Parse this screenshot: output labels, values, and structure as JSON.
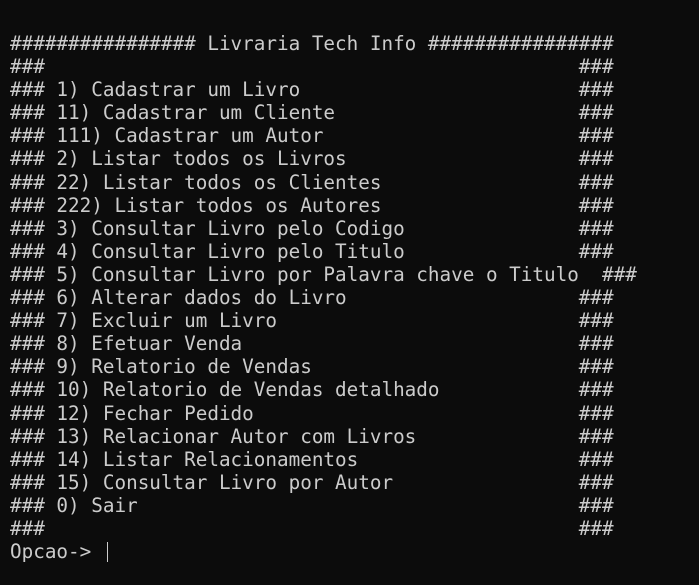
{
  "terminal": {
    "lines": [
      "################ Livraria Tech Info ################",
      "###                                              ###",
      "### 1) Cadastrar um Livro                        ###",
      "### 11) Cadastrar um Cliente                     ###",
      "### 111) Cadastrar um Autor                      ###",
      "### 2) Listar todos os Livros                    ###",
      "### 22) Listar todos os Clientes                 ###",
      "### 222) Listar todos os Autores                 ###",
      "### 3) Consultar Livro pelo Codigo               ###",
      "### 4) Consultar Livro pelo Titulo               ###",
      "### 5) Consultar Livro por Palavra chave o Titulo  ###",
      "### 6) Alterar dados do Livro                    ###",
      "### 7) Excluir um Livro                          ###",
      "### 8) Efetuar Venda                             ###",
      "### 9) Relatorio de Vendas                       ###",
      "### 10) Relatorio de Vendas detalhado            ###",
      "### 12) Fechar Pedido                            ###",
      "### 13) Relacionar Autor com Livros              ###",
      "### 14) Listar Relacionamentos                   ###",
      "### 15) Consultar Livro por Autor                ###",
      "### 0) Sair                                      ###",
      "###                                              ###"
    ],
    "prompt": "Opcao-> "
  },
  "colors": {
    "background": "#0c0c0c",
    "foreground": "#cccccc"
  }
}
